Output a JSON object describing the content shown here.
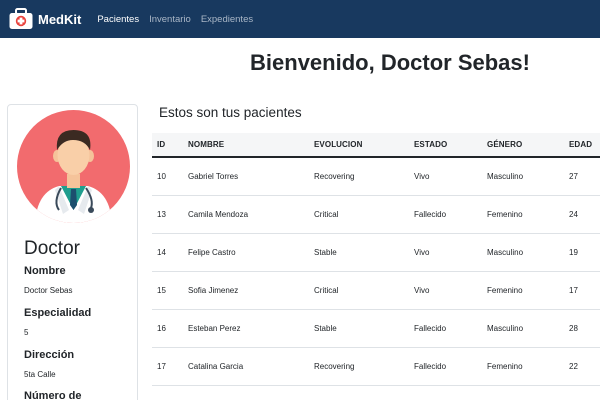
{
  "navbar": {
    "brand": "MedKit",
    "links": [
      {
        "label": "Pacientes",
        "active": true
      },
      {
        "label": "Inventario",
        "active": false
      },
      {
        "label": "Expedientes",
        "active": false
      }
    ]
  },
  "welcome": "Bienvenido, Doctor Sebas!",
  "profile": {
    "title": "Doctor",
    "fields": [
      {
        "label": "Nombre",
        "value": "Doctor Sebas"
      },
      {
        "label": "Especialidad",
        "value": "5"
      },
      {
        "label": "Dirección",
        "value": "5ta Calle"
      },
      {
        "label": "Número de",
        "value": ""
      }
    ]
  },
  "patients": {
    "title": "Estos son tus pacientes",
    "columns": [
      "ID",
      "NOMBRE",
      "EVOLUCION",
      "ESTADO",
      "GÉNERO",
      "EDAD"
    ],
    "rows": [
      [
        "10",
        "Gabriel Torres",
        "Recovering",
        "Vivo",
        "Masculino",
        "27"
      ],
      [
        "13",
        "Camila Mendoza",
        "Critical",
        "Fallecido",
        "Femenino",
        "24"
      ],
      [
        "14",
        "Felipe Castro",
        "Stable",
        "Vivo",
        "Masculino",
        "19"
      ],
      [
        "15",
        "Sofia Jimenez",
        "Critical",
        "Vivo",
        "Femenino",
        "17"
      ],
      [
        "16",
        "Esteban Perez",
        "Stable",
        "Fallecido",
        "Masculino",
        "28"
      ],
      [
        "17",
        "Catalina Garcia",
        "Recovering",
        "Fallecido",
        "Femenino",
        "22"
      ]
    ]
  },
  "colors": {
    "navbar": "#18395f",
    "avatar_bg": "#f26b6e",
    "nav_inactive": "#a9b6c6"
  },
  "icons": {
    "brand": "first-aid-kit-icon",
    "avatar": "doctor-avatar"
  }
}
